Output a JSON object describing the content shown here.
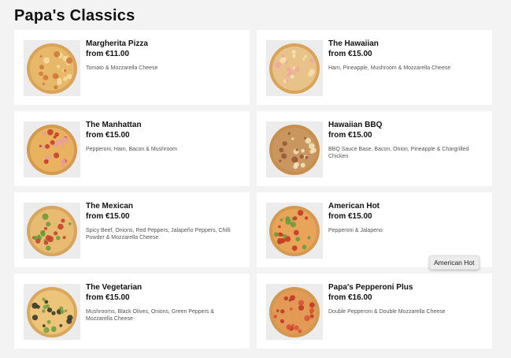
{
  "page": {
    "title": "Papa's Classics"
  },
  "menu": [
    {
      "name": "Margherita Pizza",
      "price": "from €11.00",
      "description": "Tomato & Mozzarella Cheese",
      "image": "pizza-margherita",
      "crust": "#d9a45a",
      "sauce": "#e8b86a",
      "top1": "#f5dba0",
      "top2": "#cf7a3c"
    },
    {
      "name": "The Hawaiian",
      "price": "from €15.00",
      "description": "Ham, Pineapple, Mushroom & Mozzarella Cheese",
      "image": "pizza-hawaiian",
      "crust": "#d9a45a",
      "sauce": "#e9c28a",
      "top1": "#f0a8a0",
      "top2": "#f3e0a8"
    },
    {
      "name": "The Manhattan",
      "price": "from €15.00",
      "description": "Pepperoni, Ham, Bacon & Mushroom",
      "image": "pizza-manhattan",
      "crust": "#d49a50",
      "sauce": "#e9b25e",
      "top1": "#c7402e",
      "top2": "#e8a098"
    },
    {
      "name": "Hawaiian BBQ",
      "price": "from €15.00",
      "description": "BBQ Sauce Base, Bacon, Onion, Pineapple & Chargrilled Chicken",
      "image": "pizza-hawaiian-bbq",
      "crust": "#c88e4c",
      "sauce": "#c99660",
      "top1": "#9a5a35",
      "top2": "#f0e2b8"
    },
    {
      "name": "The Mexican",
      "price": "from €15.00",
      "description": "Spicy Beef, Onions, Red Peppers, Jalapeño Peppers, Chilli Powder & Mozzarella Cheese",
      "image": "pizza-mexican",
      "crust": "#d8a55e",
      "sauce": "#e7bb72",
      "top1": "#6e9a3a",
      "top2": "#c6452e"
    },
    {
      "name": "American Hot",
      "price": "from €15.00",
      "description": "Pepperoni & Jalapeno",
      "image": "pizza-american-hot",
      "crust": "#d49a50",
      "sauce": "#e8a55a",
      "top1": "#c43a28",
      "top2": "#6f9a3c"
    },
    {
      "name": "The Vegetarian",
      "price": "from €15.00",
      "description": "Mushrooms, Black Olives, Onions, Green Peppers & Mozzarella Cheese",
      "image": "pizza-vegetarian",
      "crust": "#d9a85e",
      "sauce": "#ecc57a",
      "top1": "#3a3a2a",
      "top2": "#7aa042"
    },
    {
      "name": "Papa's Pepperoni Plus",
      "price": "from €16.00",
      "description": "Double Pepperoni & Double Mozzarella Cheese",
      "image": "pizza-pepperoni-plus",
      "crust": "#d39850",
      "sauce": "#e29a55",
      "top1": "#c23a26",
      "top2": "#d5553a"
    }
  ],
  "tooltip": {
    "text": "American Hot"
  }
}
